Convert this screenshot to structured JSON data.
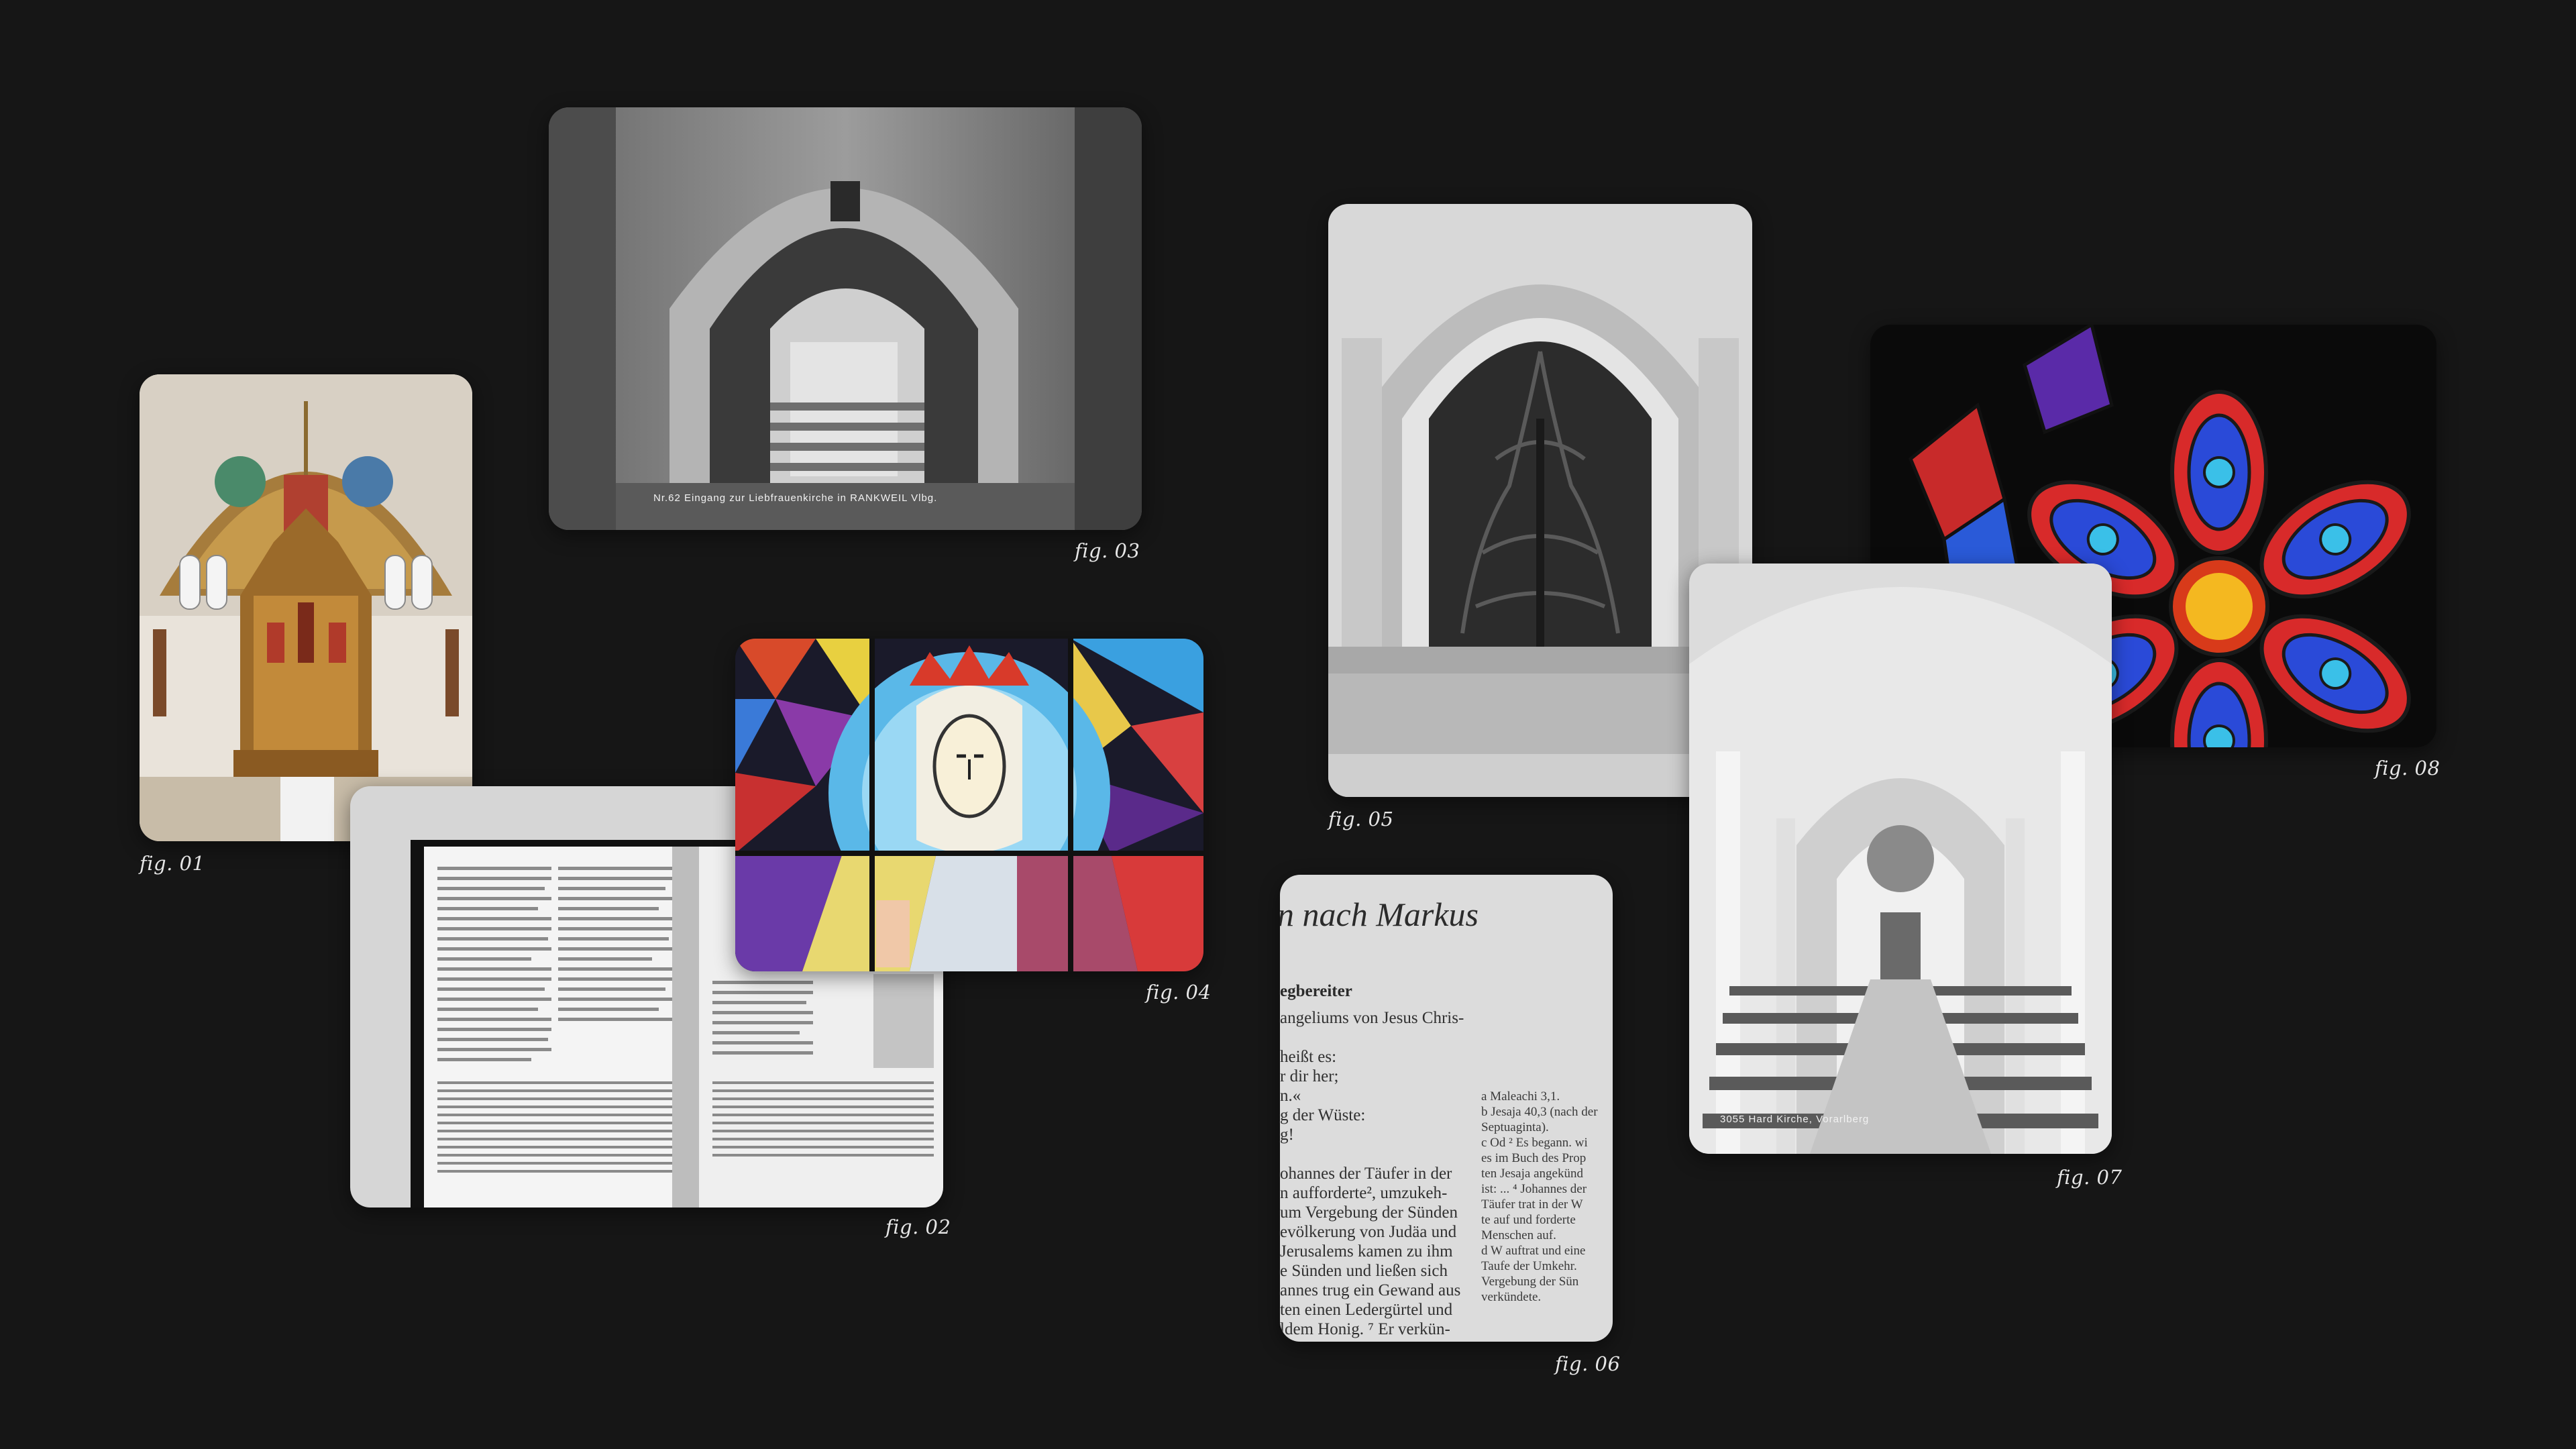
{
  "figures": [
    {
      "id": "fig01",
      "caption": "fig. 01",
      "alt": "church-apse-altar"
    },
    {
      "id": "fig02",
      "caption": "fig. 02",
      "alt": "open-bible-pages"
    },
    {
      "id": "fig03",
      "caption": "fig. 03",
      "alt": "arched-stone-passage"
    },
    {
      "id": "fig04",
      "caption": "fig. 04",
      "alt": "stained-glass-madonna"
    },
    {
      "id": "fig05",
      "caption": "fig. 05",
      "alt": "bronze-church-door"
    },
    {
      "id": "fig06",
      "caption": "fig. 06",
      "alt": "gospel-of-mark-page"
    },
    {
      "id": "fig07",
      "caption": "fig. 07",
      "alt": "church-nave-interior"
    },
    {
      "id": "fig08",
      "caption": "fig. 08",
      "alt": "rose-window-stained-glass"
    }
  ],
  "fig03_overlay": "Nr.62   Eingang zur Liebfrauenkirche in RANKWEIL Vlbg.",
  "fig07_overlay": "3055    Hard  Kirche,        Vorarlberg",
  "fig06_text": {
    "heading": "n nach Markus",
    "subheading": "egbereiter",
    "lines": [
      "angeliums von Jesus Chris-",
      "",
      "heißt es:",
      "r dir her;",
      "n.«",
      "g der Wüste:",
      "g!",
      "",
      "ohannes der Täufer in der",
      "n aufforderte², umzukeh-",
      "um Vergebung der Sünden",
      "evölkerung von Judäa und",
      "Jerusalems kamen zu ihm",
      "e Sünden und ließen sich",
      "annes trug ein Gewand aus",
      "ten einen Ledergürtel und",
      "ldem Honig. ⁷ Er verkün-"
    ],
    "notes": [
      "a  Maleachi 3,1.",
      "b  Jesaja 40,3 (nach der",
      "    Septuaginta).",
      "c  Od ² Es begann.  wi",
      "    es im Buch des Prop",
      "    ten Jesaja angekünd",
      "    ist: ... ⁴ Johannes der",
      "    Täufer trat in der W",
      "    te auf und forderte",
      "    Menschen auf.",
      "d  W auftrat und eine",
      "    Taufe der Umkehr.",
      "    Vergebung der Sün",
      "    verkündete."
    ]
  }
}
